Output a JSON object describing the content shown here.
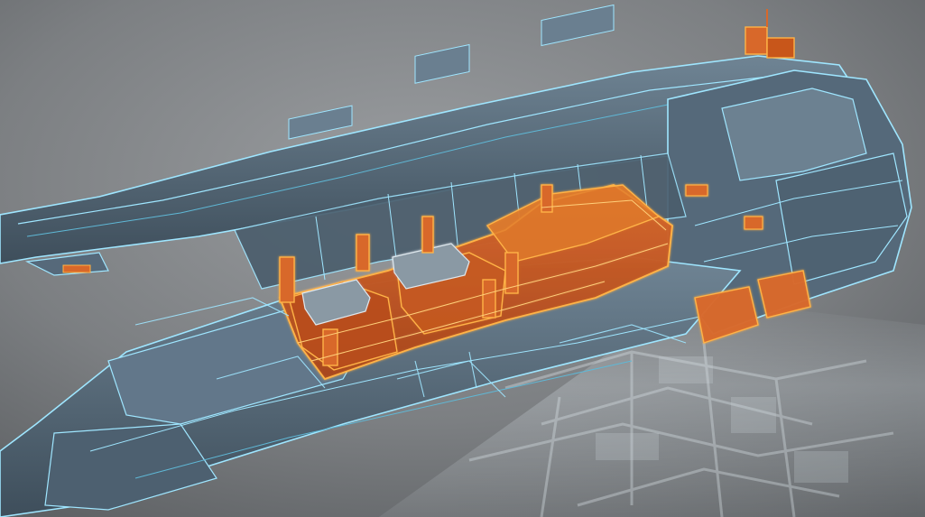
{
  "scene": {
    "description_free": true,
    "palette": {
      "background_light": "#8d9093",
      "background_dark": "#4c4f52",
      "hull_fill": "#5e7282",
      "hull_fill_dark": "#3f4f5c",
      "wire_cyan": "#9fe6ff",
      "wire_cyan_dim": "#5fb8d6",
      "cargo_fill": "#c8561a",
      "cargo_fill_light": "#e07a2a",
      "cargo_wire": "#ffb347",
      "floor_glow": "#dfe8ee"
    },
    "subject": {
      "type": "wireframe-spaceship-cutaway",
      "highlight_section": "cargo-module"
    }
  }
}
